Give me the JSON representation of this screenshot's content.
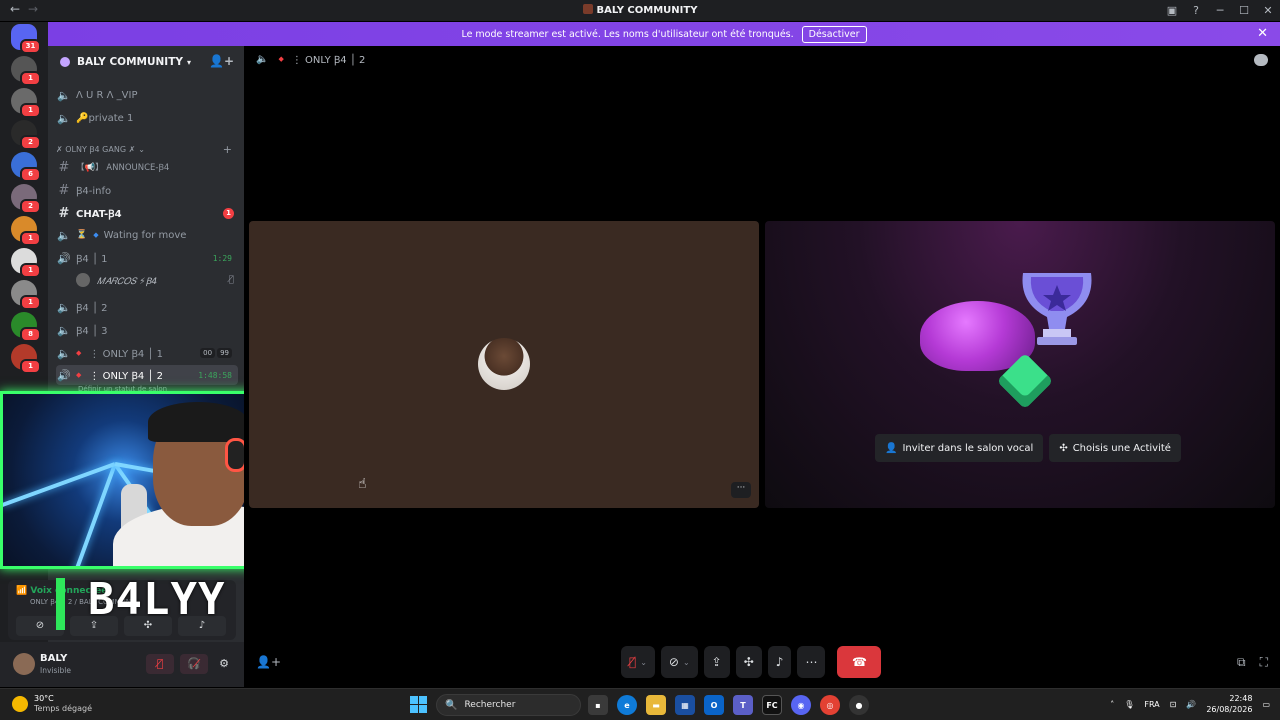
{
  "window": {
    "title": "BALY COMMUNITY"
  },
  "banner": {
    "text": "Le mode streamer est activé. Les noms d'utilisateur ont été tronqués.",
    "button": "Désactiver"
  },
  "rail": {
    "badges": [
      "31",
      "1",
      "1",
      "2",
      "6",
      "2",
      "1",
      "1",
      "1",
      "8",
      "1"
    ]
  },
  "server": {
    "name": "BALY COMMUNITY"
  },
  "channels": {
    "top": [
      {
        "name": "Λ U R Λ _VIP",
        "type": "voice"
      },
      {
        "name": "🔑private 1",
        "type": "voice"
      }
    ],
    "category": "✗ OLNY Ꞵ4 GANG ✗",
    "list": [
      {
        "name": "【📢】 ANNOUNCE-Ꞵ4",
        "type": "text"
      },
      {
        "name": "Ꞵ4-info",
        "type": "text"
      },
      {
        "name": "CHAT-Ꞵ4",
        "type": "text",
        "ping": "1"
      },
      {
        "name": "Wating for move",
        "type": "voice",
        "prefix": "⏳"
      },
      {
        "name": "Ꞵ4 │ 1",
        "type": "voice",
        "timer": "1:29"
      },
      {
        "name": "Ꞵ4 │ 2",
        "type": "voice"
      },
      {
        "name": "Ꞵ4 │ 3",
        "type": "voice"
      },
      {
        "name": "⋮ ONLY Ꞵ4 │ 1",
        "type": "voice",
        "tags": [
          "00",
          "99"
        ]
      },
      {
        "name": "⋮ ONLY Ꞵ4 │ 2",
        "type": "voice",
        "timer": "1:48:58"
      }
    ],
    "member": "𝑀𝐴𝑅𝐶𝑂𝑆 ⚡Ꞵ4",
    "status_hint": "Définir un statut de salon"
  },
  "voice_status": {
    "label": "Voix connectée",
    "sub": "ONLY Ꞵ4 │ 2 / BALY COMMUNI..."
  },
  "user": {
    "name": "BALY",
    "status": "Invisible"
  },
  "overlay": {
    "name": "B4LYY"
  },
  "main": {
    "channel": "⋮ ONLY Ꞵ4 │ 2",
    "invite_button": "Inviter dans le salon vocal",
    "activity_button": "Choisis une Activité",
    "more_button": "···"
  },
  "taskbar": {
    "temp": "30°C",
    "weather": "Temps dégagé",
    "search_placeholder": "Rechercher",
    "lang": "FRA",
    "time": "22:48",
    "date": "26/08/2026"
  },
  "colors": {
    "accent": "#8a4ae8",
    "webcam_border": "#39ff6a",
    "hangup": "#da373c"
  }
}
